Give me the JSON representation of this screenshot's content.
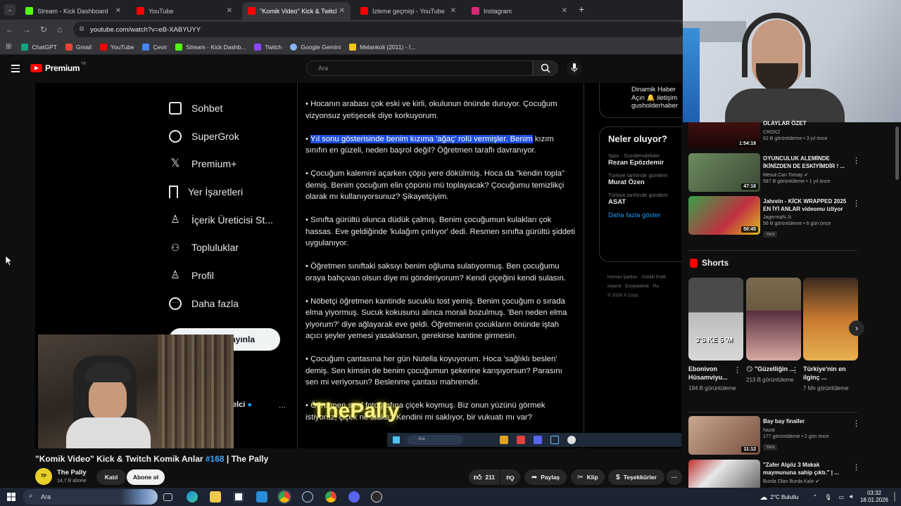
{
  "browser": {
    "tabs": [
      {
        "title": "Stream - Kick Dashboard",
        "color": "#53fc18",
        "active": false
      },
      {
        "title": "YouTube",
        "color": "#ff0000",
        "active": false
      },
      {
        "title": "\"Komik Video\" Kick & Twitch",
        "color": "#ff0000",
        "active": true
      },
      {
        "title": "İzleme geçmişi - YouTube",
        "color": "#ff0000",
        "active": false
      },
      {
        "title": "Instagram",
        "color": "#d62976",
        "active": false
      }
    ],
    "new_tab": "+",
    "url": "youtube.com/watch?v=eB-XABYUYY",
    "bookmarks": [
      {
        "label": "ChatGPT",
        "color": "#10a37f"
      },
      {
        "label": "Gmail",
        "color": "#ea4335"
      },
      {
        "label": "YouTube",
        "color": "#ff0000"
      },
      {
        "label": "Çevir",
        "color": "#4285f4"
      },
      {
        "label": "Stream - Kick Dashb...",
        "color": "#53fc18"
      },
      {
        "label": "Twitch",
        "color": "#9146ff"
      },
      {
        "label": "Google Gemini",
        "color": "#8ab4f8"
      },
      {
        "label": "Melankoli (2011) - İ...",
        "color": "#f5c518"
      }
    ]
  },
  "youtube": {
    "logo": "Premium",
    "logo_sup": "TR",
    "search_placeholder": "Ara"
  },
  "video_frame": {
    "x_nav": [
      {
        "label": "Sohbet",
        "icon": "chat-icon"
      },
      {
        "label": "SuperGrok",
        "icon": "grok-icon"
      },
      {
        "label": "Premium+",
        "icon": "x-logo-icon"
      },
      {
        "label": "Yer İşaretleri",
        "icon": "bookmark-icon"
      },
      {
        "label": "İçerik Üreticisi St...",
        "icon": "creator-icon"
      },
      {
        "label": "Topluluklar",
        "icon": "communities-icon"
      },
      {
        "label": "Profil",
        "icon": "profile-icon"
      },
      {
        "label": "Daha fazla",
        "icon": "more-circle-icon"
      }
    ],
    "post_button": "ayınla",
    "account_fragment": "elci",
    "tweet_paragraphs": [
      "• Hocanın arabası çok eski ve kirli, okulunun önünde duruyor. Çocuğum vizyonsuz yetişecek diye korkuyorum.",
      "• Çocuğum kalemini açarken çöpü yere dökülmüş. Hoca da \"kendin topla\" demiş. Benim çocuğum elin çöpünü mü toplayacak? Çocuğumu temizlikçi olarak mı kullanıyorsunuz? Şikayetçiyim.",
      "• Sınıfta gürültü olunca düdük çalmış. Benim çocuğumun kulakları çok hassas. Eve geldiğinde 'kulağım çınlıyor' dedi. Resmen sınıfta gürültü şiddeti uygulanıyor.",
      "• Öğretmen sınıftaki saksıyı benim oğluma sulatıyormuş. Ben çocuğumu oraya bahçıvan olsun diye mi gönderiyorum? Kendi çiçeğini kendi sulasın.",
      "• Nöbetçi öğretmen kantinde sucuklu tost yemiş. Benim çocuğum o sırada elma yiyormuş. Sucuk kokusunu alınca morali bozulmuş. 'Ben neden elma yiyorum?' diye ağlayarak eve geldi. Öğretmenin çocukların önünde iştah açıcı şeyler yemesi yasaklansın, gerekirse kantine girmesin.",
      "• Çocuğum çantasına her gün Nutella koyuyorum. Hoca 'sağlıklı beslen' demiş. Sen kimsin de benim çocuğumun şekerine karışıyorsun? Parasını sen mi veriyorsun? Beslenme çantası mahremdir.",
      "• Öğretmen sınıf fotoğrafına çiçek koymuş. Biz onun yüzünü görmek istiyoruz, çiçek ne alaka? Kendini mi saklıyor, bir vukuatı mı var?"
    ],
    "highlight_text": "Yıl sonu gösterisinde benim kızıma 'ağaç' rolü vermişler. Benim",
    "highlight_rest": " kızım sınıfın en güzeli, neden başrol değil? Öğretmen taraflı davranıyor.",
    "side_header": {
      "line1": "Dinamik Haber",
      "line2": "Açın 🔔 iletişim",
      "line3": "gusholderhaber"
    },
    "trends_title": "Neler oluyor?",
    "trends": [
      {
        "context": "Spor · Gündemdekiler",
        "topic": "Rezan Epözdemir"
      },
      {
        "context": "Türkiye tarihinde gündem",
        "topic": "Murat Özen"
      },
      {
        "context": "Türkiye tarihinde gündem",
        "topic": "ASAT"
      }
    ],
    "show_more": "Daha fazla göster",
    "footer_links": [
      "Hizmet Şartları",
      "Gizlilik Politi",
      "Imprint",
      "Erişilebilirlik",
      "Re"
    ],
    "copyright": "© 2026 X Corp.",
    "overlay_text": "ThePally",
    "mini_search": "Ara"
  },
  "video": {
    "title_prefix": "\"Komik Video\" Kick & Twitch Komik Anlar ",
    "title_tag": "#168",
    "title_suffix": " | The Pally",
    "channel": "The Pally",
    "subscribers": "14,7 B abone",
    "join_label": "Katıl",
    "subscribe_label": "Abone ol",
    "likes": "211",
    "share_label": "Paylaş",
    "clip_label": "Klip",
    "thanks_label": "Teşekkürler"
  },
  "sidebar": {
    "partial_item": {
      "title": "OLAYLAR ÖZET",
      "channel": "CROXZ",
      "meta": "62 B görüntüleme • 3 yıl önce",
      "duration": "1:54:18"
    },
    "videos": [
      {
        "title": "OYUNCULUK ALEMİNDE İKİNİZDEN DE ESKİYİMDİR ! ...",
        "channel": "Mesut Can Tomay ✔",
        "meta": "587 B görüntüleme • 1 yıl önce",
        "duration": "47:18",
        "thumb": "#5a7a50"
      },
      {
        "title": "Jahrein - KİCK WRAPPED 2025 EN İYİ ANLAR videomu izliyor",
        "channel": "JagermaN Jr.",
        "meta": "56 B görüntüleme • 6 gün önce",
        "duration": "50:45",
        "badge": "Yeni",
        "thumb": "#b03040"
      }
    ],
    "shorts_label": "Shorts",
    "shorts": [
      {
        "title": "Ebonivon Hüsamviyu...",
        "views": "194 B görüntüleme",
        "thumb_text": "3'S KE 5 'M"
      },
      {
        "title": "😏 \"Güzelliğin ...",
        "views": "213 B görüntüleme"
      },
      {
        "title": "Türkiye'nin en ilginç ...",
        "views": "7 Mn görüntüleme"
      }
    ],
    "more_videos": [
      {
        "title": "Bay bay finaller",
        "channel": "hazal",
        "meta": "177 görüntüleme • 2 gün önce",
        "duration": "11:12",
        "badge": "Yeni"
      },
      {
        "title": "\"Zafer Algöz 3 Makak maymununa sahip çıktı.\" | ...",
        "channel": "Burda Olan Burda Kalır ✔",
        "meta": "",
        "duration": ""
      }
    ]
  },
  "taskbar": {
    "search": "Ara",
    "weather": "2°C  Bulutlu",
    "time": "03:32",
    "date": "18.01.2026"
  }
}
